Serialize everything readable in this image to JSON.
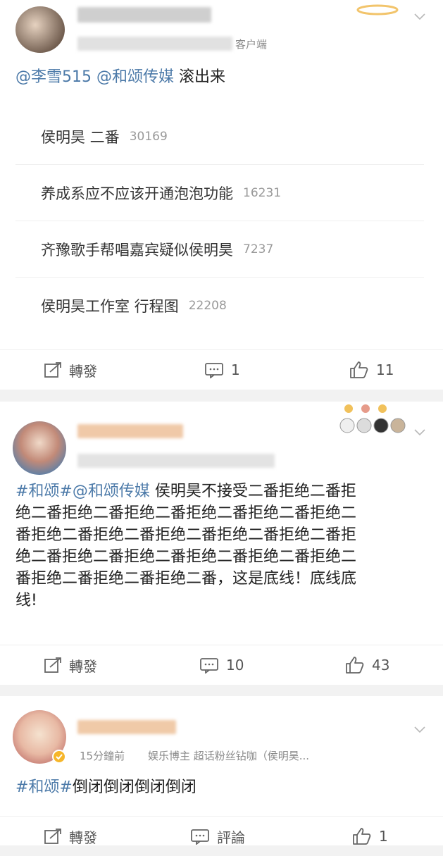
{
  "post1": {
    "source_fragment": "客户端",
    "text_mention": "@李雪515 @和颂传媒",
    "text_body": "滚出来",
    "hot_items": [
      {
        "title": "侯明昊 二番",
        "count": "30169"
      },
      {
        "title": "养成系应不应该开通泡泡功能",
        "count": "16231"
      },
      {
        "title": "齐豫歌手帮唱嘉宾疑似侯明昊",
        "count": "7237"
      },
      {
        "title": "侯明昊工作室 行程图",
        "count": "22208"
      }
    ],
    "repost_label": "轉發",
    "comment_count": "1",
    "like_count": "11"
  },
  "post2": {
    "line1_tags": "#和颂#@和颂传媒",
    "line1_text": "侯明昊不接受二番拒绝二番拒",
    "lines": [
      "绝二番拒绝二番拒绝二番拒绝二番拒绝二番拒绝二",
      "番拒绝二番拒绝二番拒绝二番拒绝二番拒绝二番拒",
      "绝二番拒绝二番拒绝二番拒绝二番拒绝二番拒绝二",
      "番拒绝二番拒绝二番拒绝二番，这是底线！底线底",
      "线!"
    ],
    "repost_label": "轉發",
    "comment_count": "10",
    "like_count": "43"
  },
  "post3": {
    "time": "15分鐘前",
    "user_tags": "娱乐博主 超话粉丝钻咖（侯明昊...",
    "text_tag": "#和颂#",
    "text_body": "倒闭倒闭倒闭倒闭",
    "repost_label": "轉發",
    "comment_label": "評論",
    "like_count": "1"
  },
  "colors": {
    "link": "#4b79a8",
    "gray": "#999999",
    "background": "#f2f2f2"
  }
}
